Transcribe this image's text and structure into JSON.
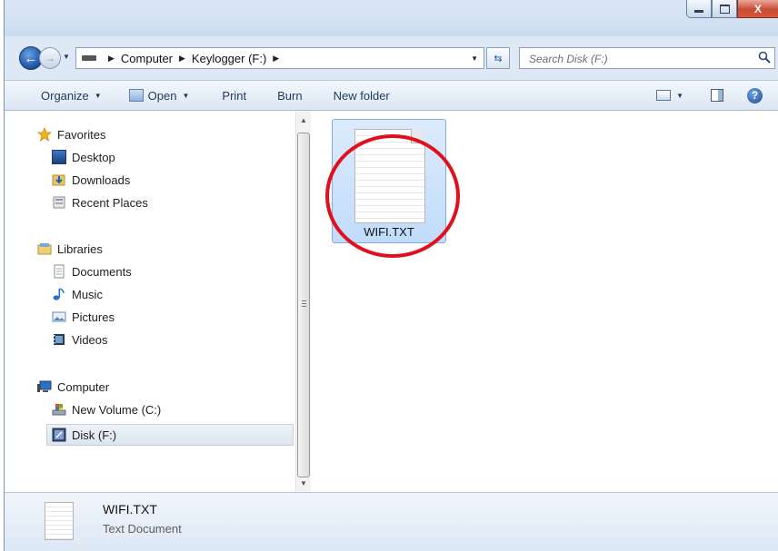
{
  "window": {
    "controls": {
      "minimize": "",
      "maximize": "",
      "close": "X"
    }
  },
  "address": {
    "breadcrumbs": [
      "Computer",
      "Keylogger (F:)"
    ],
    "search_placeholder": "Search Disk (F:)"
  },
  "toolbar": {
    "organize": "Organize",
    "open": "Open",
    "print": "Print",
    "burn": "Burn",
    "new_folder": "New folder"
  },
  "nav": {
    "favorites": {
      "label": "Favorites",
      "icon": "star-icon",
      "items": [
        {
          "label": "Desktop",
          "icon": "desktop-icon"
        },
        {
          "label": "Downloads",
          "icon": "downloads-icon"
        },
        {
          "label": "Recent Places",
          "icon": "recent-places-icon"
        }
      ]
    },
    "libraries": {
      "label": "Libraries",
      "icon": "libraries-icon",
      "items": [
        {
          "label": "Documents",
          "icon": "documents-icon"
        },
        {
          "label": "Music",
          "icon": "music-icon"
        },
        {
          "label": "Pictures",
          "icon": "pictures-icon"
        },
        {
          "label": "Videos",
          "icon": "videos-icon"
        }
      ]
    },
    "computer": {
      "label": "Computer",
      "icon": "computer-icon",
      "items": [
        {
          "label": "New Volume (C:)",
          "icon": "drive-c-icon"
        },
        {
          "label": "Disk (F:)",
          "icon": "drive-f-icon",
          "selected": true
        }
      ]
    }
  },
  "content": {
    "files": [
      {
        "name": "WIFI.TXT",
        "icon": "text-file-icon",
        "selected": true
      }
    ],
    "annotation_color": "#e0101c"
  },
  "details": {
    "name": "WIFI.TXT",
    "type": "Text Document"
  },
  "colors": {
    "accent": "#1a4f9b",
    "selection": "#c1dcfc",
    "chrome": "#dfe9f5"
  }
}
